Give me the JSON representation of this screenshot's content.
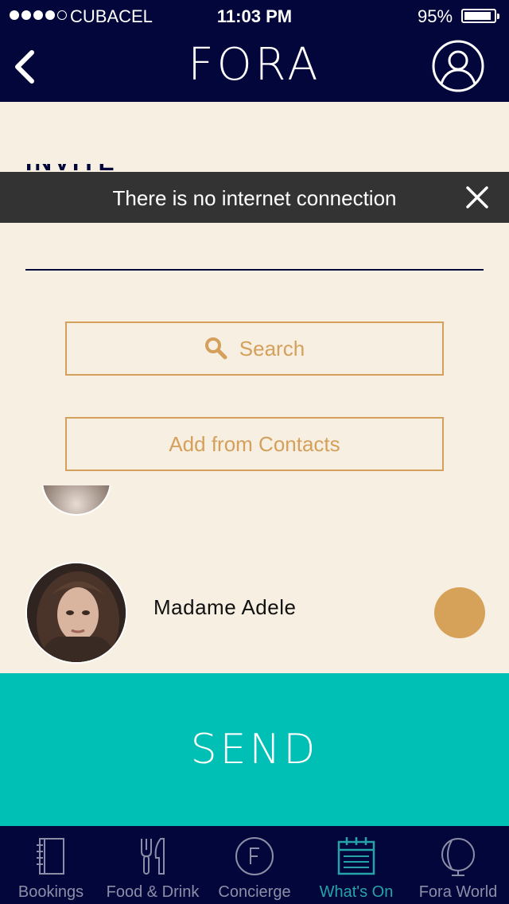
{
  "status_bar": {
    "carrier": "CUBACEL",
    "time": "11:03 PM",
    "battery": "95%",
    "battery_level": 0.95,
    "signal_bars": 4,
    "signal_max": 5
  },
  "nav": {
    "logo": "FORA",
    "back_icon": "chevron-left-icon",
    "profile_icon": "user-circle-icon"
  },
  "page": {
    "title_partial": "INVITE"
  },
  "banner": {
    "message": "There is no internet connection",
    "close_icon": "close-icon",
    "background": "#333333"
  },
  "search": {
    "label": "Search",
    "icon": "magnifier-icon"
  },
  "contacts_button": {
    "label": "Add from Contacts"
  },
  "contacts": [
    {
      "name": "Madame Adele",
      "selected": true
    }
  ],
  "send": {
    "label": "SEND",
    "color": "#00bfb4"
  },
  "tabs": [
    {
      "label": "Bookings",
      "icon": "notebook-icon",
      "active": false
    },
    {
      "label": "Food & Drink",
      "icon": "cutlery-icon",
      "active": false
    },
    {
      "label": "Concierge",
      "icon": "concierge-f-icon",
      "active": false
    },
    {
      "label": "What's On",
      "icon": "calendar-icon",
      "active": true
    },
    {
      "label": "Fora World",
      "icon": "globe-icon",
      "active": false
    }
  ],
  "colors": {
    "navy": "#03063a",
    "accent": "#d4a05b",
    "teal": "#00bfb4",
    "active_tab": "#26a3a8",
    "background": "#f7efe1"
  }
}
